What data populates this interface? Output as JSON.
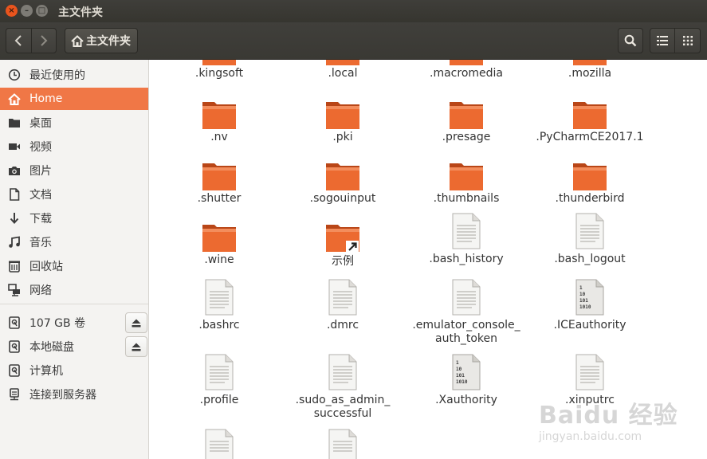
{
  "window": {
    "title": "主文件夹"
  },
  "header": {
    "path_label": "主文件夹"
  },
  "sidebar": {
    "places": [
      {
        "label": "最近使用的",
        "icon": "clock-icon"
      },
      {
        "label": "Home",
        "icon": "home-icon",
        "active": true
      },
      {
        "label": "桌面",
        "icon": "folder-icon"
      },
      {
        "label": "视频",
        "icon": "video-icon"
      },
      {
        "label": "图片",
        "icon": "camera-icon"
      },
      {
        "label": "文档",
        "icon": "document-icon"
      },
      {
        "label": "下载",
        "icon": "download-icon"
      },
      {
        "label": "音乐",
        "icon": "music-icon"
      },
      {
        "label": "回收站",
        "icon": "trash-icon"
      },
      {
        "label": "网络",
        "icon": "network-icon"
      }
    ],
    "devices": [
      {
        "label": "107 GB 卷",
        "icon": "drive-icon",
        "eject": true
      },
      {
        "label": "本地磁盘",
        "icon": "drive-icon",
        "eject": true
      },
      {
        "label": "计算机",
        "icon": "drive-icon"
      },
      {
        "label": "连接到服务器",
        "icon": "server-icon"
      }
    ]
  },
  "files": {
    "row0": [
      ".kingsoft",
      ".local",
      ".macromedia",
      ".mozilla"
    ],
    "row1": [
      ".nv",
      ".pki",
      ".presage",
      ".PyCharmCE2017.1"
    ],
    "row2": [
      ".shutter",
      ".sogouinput",
      ".thumbnails",
      ".thunderbird"
    ],
    "row3": [
      ".wine",
      "示例",
      ".bash_history",
      ".bash_logout"
    ],
    "row4": [
      ".bashrc",
      ".dmrc",
      ".emulator_console_\nauth_token",
      ".ICEauthority"
    ],
    "row5": [
      ".profile",
      ".sudo_as_admin_\nsuccessful",
      ".Xauthority",
      ".xinputrc"
    ]
  },
  "colors": {
    "accent": "#f07746",
    "folder_orange": "#e8632c",
    "titlebar": "#3c3b37"
  },
  "watermark": {
    "brand": "Baidu 经验",
    "url": "jingyan.baidu.com"
  }
}
